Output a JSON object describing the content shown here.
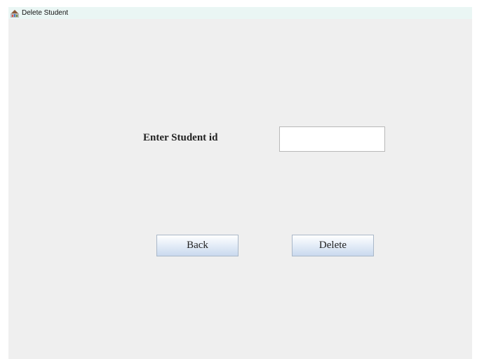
{
  "window": {
    "title": "Delete Student",
    "icon": "java-cup-icon"
  },
  "form": {
    "student_id_label": "Enter Student id",
    "student_id_value": "",
    "student_id_placeholder": ""
  },
  "buttons": {
    "back_label": "Back",
    "delete_label": "Delete"
  },
  "colors": {
    "background": "#efefef",
    "titlebar": "#eaf6f4",
    "button_gradient_bottom": "#c9d9ee"
  }
}
